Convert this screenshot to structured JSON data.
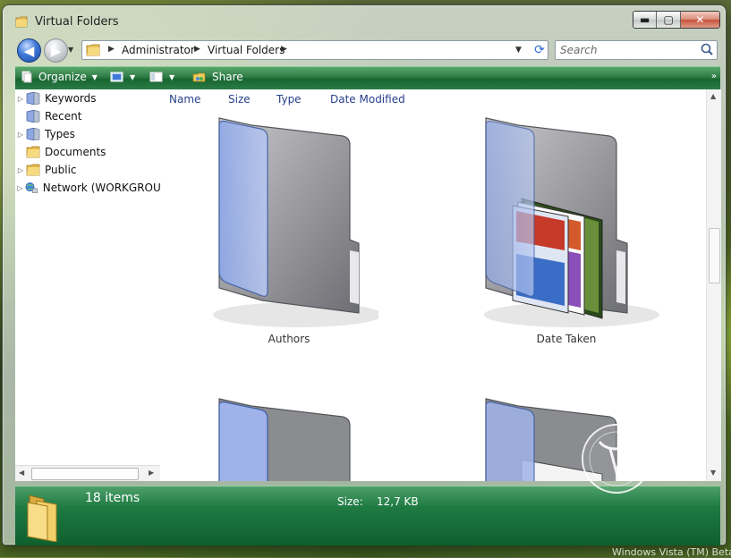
{
  "window": {
    "title": "Virtual Folders",
    "buttons": {
      "minimize": "▬",
      "maximize": "▢",
      "close": "✕"
    }
  },
  "address": {
    "crumbs": [
      "Administrator",
      "Virtual Folders"
    ],
    "search_placeholder": "Search"
  },
  "toolbar": {
    "organize": "Organize",
    "share": "Share"
  },
  "tree": {
    "items": [
      {
        "label": "Keywords",
        "icon": "virtual-folder-icon",
        "expandable": true
      },
      {
        "label": "Recent",
        "icon": "virtual-folder-icon",
        "expandable": false
      },
      {
        "label": "Types",
        "icon": "virtual-folder-icon",
        "expandable": true
      },
      {
        "label": "Documents",
        "icon": "folder-icon",
        "expandable": false
      },
      {
        "label": "Public",
        "icon": "folder-icon",
        "expandable": true
      },
      {
        "label": "Network (WORKGROUP",
        "icon": "network-icon",
        "expandable": true
      }
    ]
  },
  "columns": [
    "Name",
    "Size",
    "Type",
    "Date Modified"
  ],
  "folders": [
    {
      "label": "Authors",
      "icon": "virtual-folder-icon"
    },
    {
      "label": "Date Taken",
      "icon": "virtual-folder-thumbnails-icon"
    },
    {
      "label": "",
      "icon": "virtual-folder-icon"
    },
    {
      "label": "",
      "icon": "virtual-folder-thumbnails-icon"
    }
  ],
  "details": {
    "count": "18 items",
    "size_label": "Size:",
    "size_value": "12,7 KB"
  },
  "watermark": "Windows Vista (TM) Beta",
  "colors": {
    "toolbar_green": "#2d7a45",
    "details_green": "#1f7a42",
    "link_blue": "#27408b",
    "nav_blue": "#3f78d8"
  }
}
